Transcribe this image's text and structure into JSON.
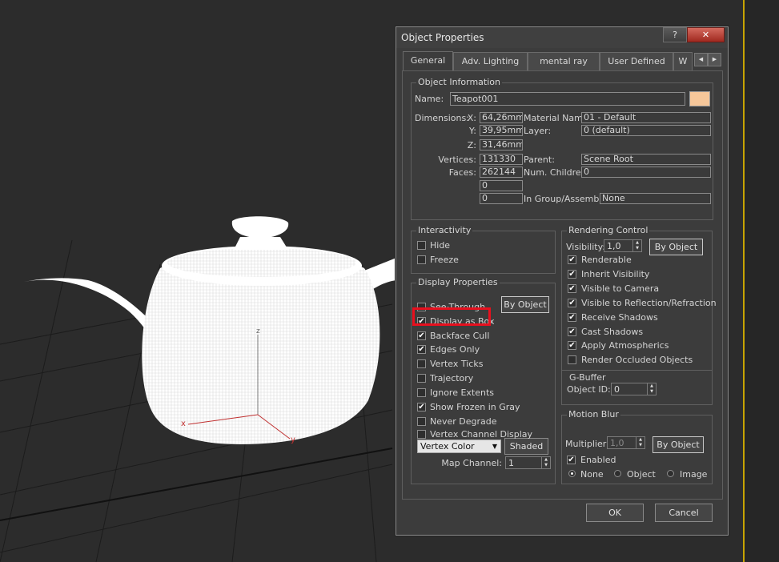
{
  "dialog": {
    "title": "Object Properties",
    "help_glyph": "?",
    "close_glyph": "✕"
  },
  "tabs": [
    {
      "label": "General"
    },
    {
      "label": "Adv. Lighting"
    },
    {
      "label": "mental ray"
    },
    {
      "label": "User Defined"
    },
    {
      "label": "W"
    }
  ],
  "tab_scroll": {
    "left": "◀",
    "right": "▶"
  },
  "object_info": {
    "group_title": "Object Information",
    "name_label": "Name:",
    "name_value": "Teapot001",
    "color_swatch": "#f6c79a",
    "dimensions_label": "Dimensions:",
    "x_label": "X:",
    "x_value": "64,26mm",
    "y_label": "Y:",
    "y_value": "39,95mm",
    "z_label": "Z:",
    "z_value": "31,46mm",
    "vertices_label": "Vertices:",
    "vertices_value": "131330",
    "faces_label": "Faces:",
    "faces_value": "262144",
    "extra1_value": "0",
    "extra2_value": "0",
    "material_label": "Material Name:",
    "material_value": "01 - Default",
    "layer_label": "Layer:",
    "layer_value": "0 (default)",
    "parent_label": "Parent:",
    "parent_value": "Scene Root",
    "children_label": "Num. Children:",
    "children_value": "0",
    "group_label": "In Group/Assembly:",
    "group_value": "None"
  },
  "interactivity": {
    "group_title": "Interactivity",
    "hide": "Hide",
    "freeze": "Freeze"
  },
  "display_properties": {
    "group_title": "Display Properties",
    "by_object": "By Object",
    "items": [
      {
        "label": "See-Through",
        "checked": false
      },
      {
        "label": "Display as Box",
        "checked": true
      },
      {
        "label": "Backface Cull",
        "checked": true
      },
      {
        "label": "Edges Only",
        "checked": true
      },
      {
        "label": "Vertex Ticks",
        "checked": false
      },
      {
        "label": "Trajectory",
        "checked": false
      },
      {
        "label": "Ignore Extents",
        "checked": false
      },
      {
        "label": "Show Frozen in Gray",
        "checked": true
      },
      {
        "label": "Never Degrade",
        "checked": false
      },
      {
        "label": "Vertex Channel Display",
        "checked": false
      }
    ],
    "vertex_color": "Vertex Color",
    "shaded": "Shaded",
    "map_channel_label": "Map Channel:",
    "map_channel_value": "1"
  },
  "rendering_control": {
    "group_title": "Rendering Control",
    "visibility_label": "Visibility:",
    "visibility_value": "1,0",
    "by_object": "By Object",
    "items": [
      {
        "label": "Renderable",
        "checked": true
      },
      {
        "label": "Inherit Visibility",
        "checked": true
      },
      {
        "label": "Visible to Camera",
        "checked": true
      },
      {
        "label": "Visible to Reflection/Refraction",
        "checked": true
      },
      {
        "label": "Receive Shadows",
        "checked": true
      },
      {
        "label": "Cast Shadows",
        "checked": true
      },
      {
        "label": "Apply Atmospherics",
        "checked": true
      },
      {
        "label": "Render Occluded Objects",
        "checked": false
      }
    ]
  },
  "gbuffer": {
    "group_title": "G-Buffer",
    "object_id_label": "Object ID:",
    "object_id_value": "0"
  },
  "motion_blur": {
    "group_title": "Motion Blur",
    "multiplier_label": "Multiplier:",
    "multiplier_value": "1,0",
    "by_object": "By Object",
    "enabled_label": "Enabled",
    "enabled_checked": true,
    "none": "None",
    "object": "Object",
    "image": "Image",
    "selected": "None"
  },
  "footer": {
    "ok": "OK",
    "cancel": "Cancel"
  },
  "viewport": {
    "axis_x": "x",
    "axis_y": "y",
    "axis_z": "z"
  }
}
